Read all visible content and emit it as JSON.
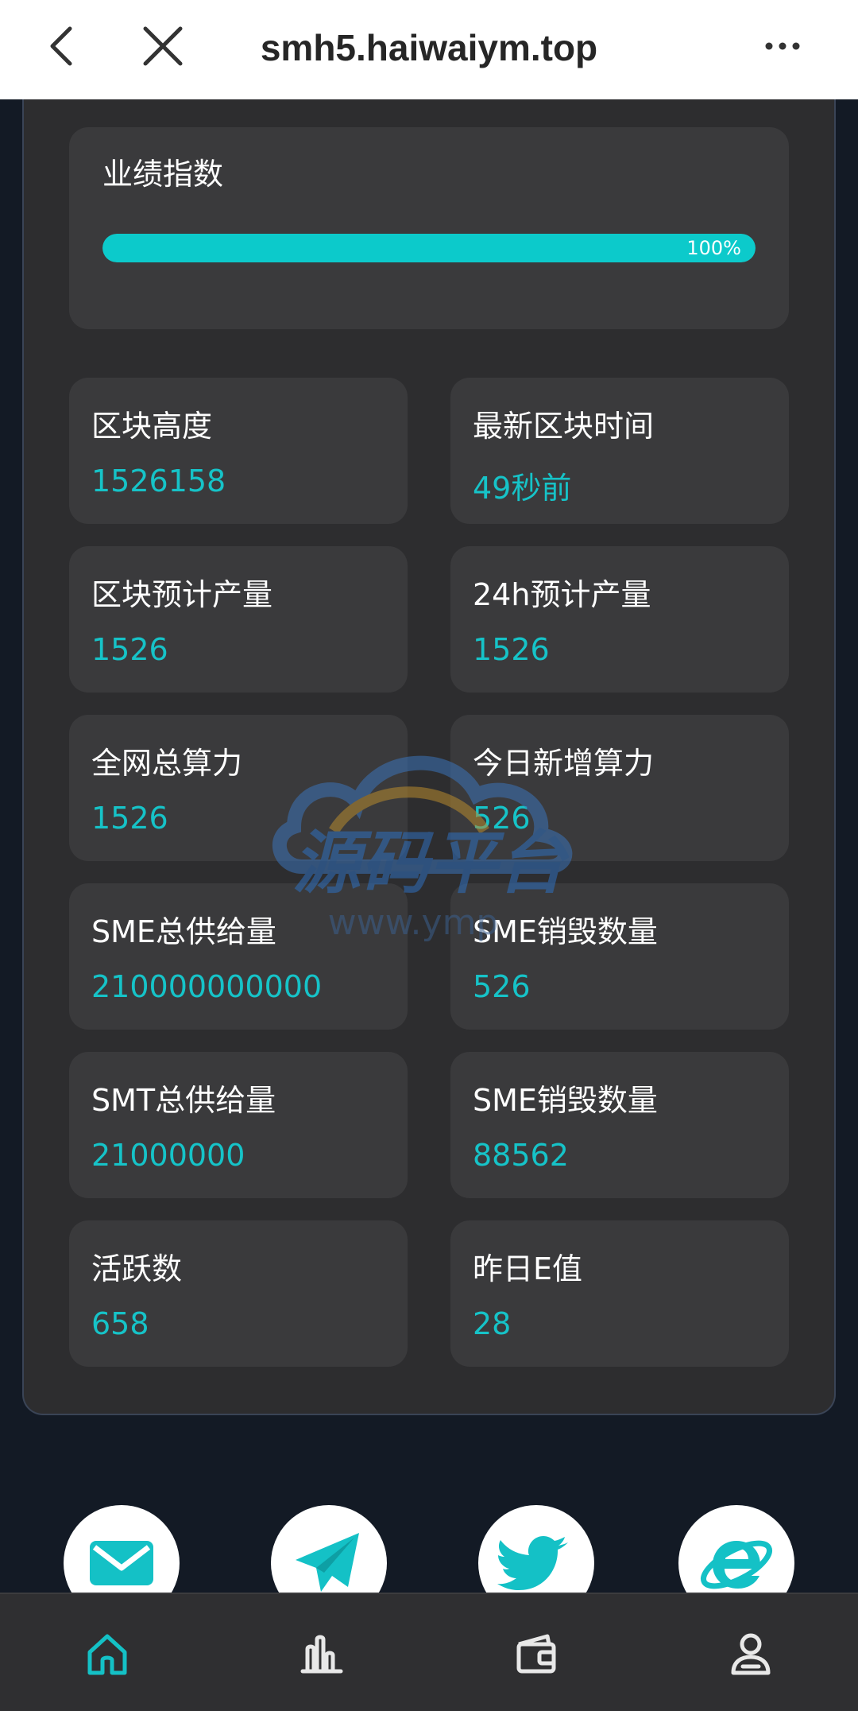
{
  "browser": {
    "url": "smh5.haiwaiym.top"
  },
  "performance": {
    "title": "业绩指数",
    "percent": 100,
    "percent_label": "100%"
  },
  "stats": [
    {
      "label": "区块高度",
      "value": "1526158"
    },
    {
      "label": "最新区块时间",
      "value": "49秒前"
    },
    {
      "label": "区块预计产量",
      "value": "1526"
    },
    {
      "label": "24h预计产量",
      "value": "1526"
    },
    {
      "label": "全网总算力",
      "value": "1526"
    },
    {
      "label": "今日新增算力",
      "value": "526"
    },
    {
      "label": "SME总供给量",
      "value": "210000000000"
    },
    {
      "label": "SME销毁数量",
      "value": "526"
    },
    {
      "label": "SMT总供给量",
      "value": "21000000"
    },
    {
      "label": "SME销毁数量",
      "value": "88562"
    },
    {
      "label": "活跃数",
      "value": "658"
    },
    {
      "label": "昨日E值",
      "value": "28"
    }
  ],
  "watermark": {
    "title": "源码平台",
    "subtitle": "www.ymp"
  },
  "social": [
    {
      "icon": "mail-icon"
    },
    {
      "icon": "telegram-icon"
    },
    {
      "icon": "twitter-icon"
    },
    {
      "icon": "ie-browser-icon"
    }
  ],
  "bottom_nav": [
    {
      "icon": "home-icon",
      "active": true
    },
    {
      "icon": "chart-icon",
      "active": false
    },
    {
      "icon": "wallet-icon",
      "active": false
    },
    {
      "icon": "user-icon",
      "active": false
    }
  ],
  "colors": {
    "accent": "#0ccacb",
    "value_text": "#16c3c8",
    "page_bg": "#131a25",
    "panel_bg": "#2d2d2f",
    "card_bg": "#3a3a3c"
  }
}
